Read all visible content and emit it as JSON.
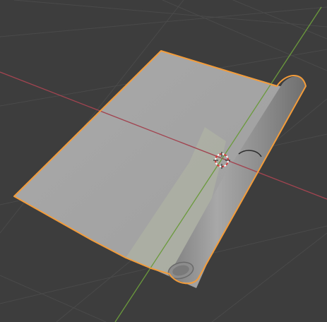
{
  "viewport": {
    "kind": "3d-viewport",
    "background_color": "#3d3d3d",
    "grid_color": "#4b4b4b",
    "x_axis_color": "#a14450",
    "y_axis_color": "#6b9a3c",
    "selection_outline_color": "#f39c3a"
  },
  "scene": {
    "object": {
      "shape": "rolled-sheet",
      "selected": true,
      "surface_color": "#a6a6a6",
      "cylinder_color": "#8f8f8f"
    },
    "cursor": {
      "icon": "3d-cursor-icon"
    }
  }
}
